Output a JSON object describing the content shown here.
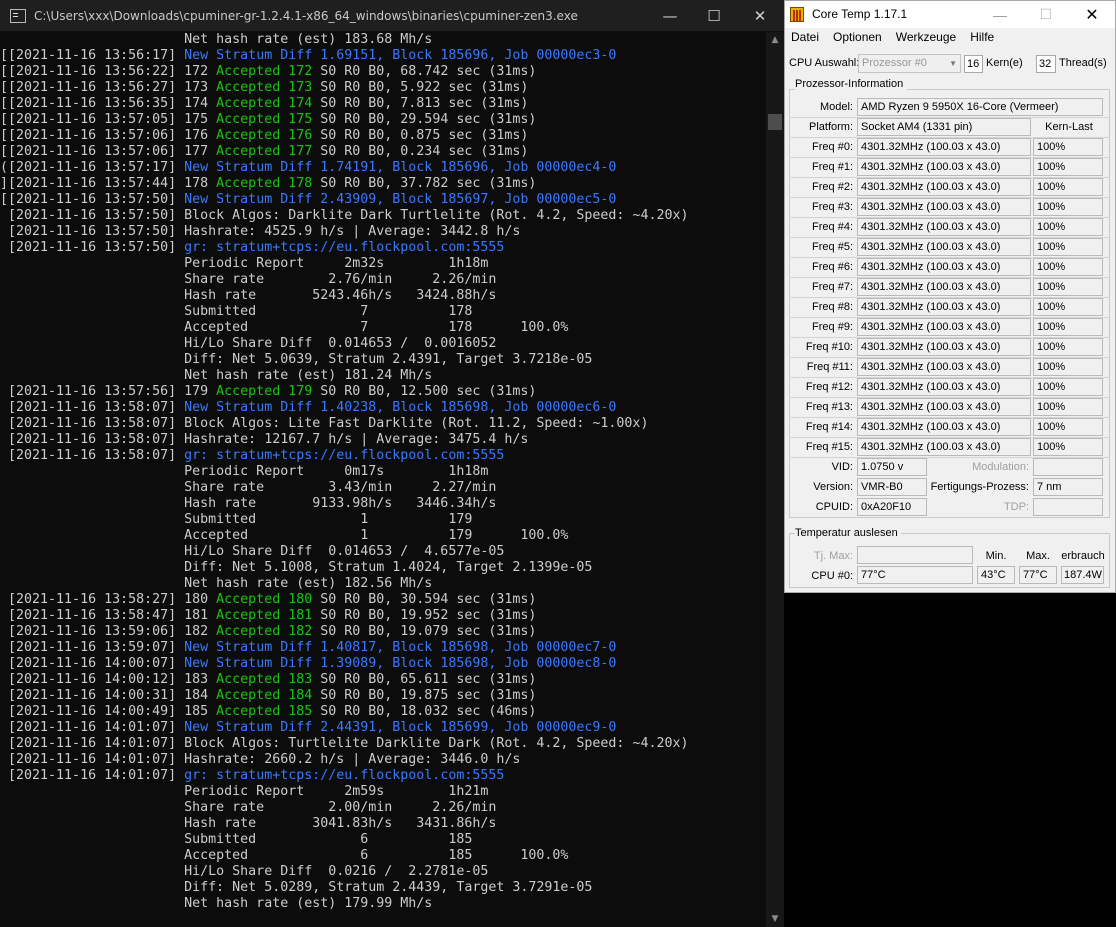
{
  "console": {
    "title": "C:\\Users\\xxx\\Downloads\\cpuminer-gr-1.2.4.1-x86_64_windows\\binaries\\cpuminer-zen3.exe",
    "controls": {
      "minimize": "—",
      "maximize": "☐",
      "close": "✕"
    },
    "lines": [
      {
        "ts": " ",
        "plain": "                      Net hash rate (est) 183.68 Mh/s"
      },
      {
        "ts": "[",
        "plain": "[2021-11-16 13:56:17] ",
        "blue": "New Stratum Diff 1.69151, Block 185696, Job 00000ec3-0"
      },
      {
        "ts": "[",
        "plain": "[2021-11-16 13:56:22] 172 ",
        "green": "Accepted 172",
        "rest": " S0 R0 B0, 68.742 sec (31ms)"
      },
      {
        "ts": "[",
        "plain": "[2021-11-16 13:56:27] 173 ",
        "green": "Accepted 173",
        "rest": " S0 R0 B0, 5.922 sec (31ms)"
      },
      {
        "ts": "[",
        "plain": "[2021-11-16 13:56:35] 174 ",
        "green": "Accepted 174",
        "rest": " S0 R0 B0, 7.813 sec (31ms)"
      },
      {
        "ts": "[",
        "plain": "[2021-11-16 13:57:05] 175 ",
        "green": "Accepted 175",
        "rest": " S0 R0 B0, 29.594 sec (31ms)"
      },
      {
        "ts": "[",
        "plain": "[2021-11-16 13:57:06] 176 ",
        "green": "Accepted 176",
        "rest": " S0 R0 B0, 0.875 sec (31ms)"
      },
      {
        "ts": "[",
        "plain": "[2021-11-16 13:57:06] 177 ",
        "green": "Accepted 177",
        "rest": " S0 R0 B0, 0.234 sec (31ms)"
      },
      {
        "ts": "(",
        "plain": "[2021-11-16 13:57:17] ",
        "blue": "New Stratum Diff 1.74191, Block 185696, Job 00000ec4-0"
      },
      {
        "ts": "]",
        "plain": "[2021-11-16 13:57:44] 178 ",
        "green": "Accepted 178",
        "rest": " S0 R0 B0, 37.782 sec (31ms)"
      },
      {
        "ts": "[",
        "plain": "[2021-11-16 13:57:50] ",
        "blue": "New Stratum Diff 2.43909, Block 185697, Job 00000ec5-0"
      },
      {
        "ts": " ",
        "plain": "[2021-11-16 13:57:50] Block Algos: Darklite Dark Turtlelite (Rot. 4.2, Speed: ~4.20x)"
      },
      {
        "ts": " ",
        "plain": "[2021-11-16 13:57:50] Hashrate: 4525.9 h/s | Average: 3442.8 h/s"
      },
      {
        "ts": " ",
        "plain": "[2021-11-16 13:57:50] ",
        "blue": "gr: stratum+tcps://eu.flockpool.com:5555"
      },
      {
        "ts": " ",
        "plain": "                      Periodic Report     2m32s        1h18m"
      },
      {
        "ts": " ",
        "plain": "                      Share rate        2.76/min     2.26/min"
      },
      {
        "ts": " ",
        "plain": "                      Hash rate       5243.46h/s   3424.88h/s"
      },
      {
        "ts": " ",
        "plain": "                      Submitted             7          178"
      },
      {
        "ts": " ",
        "plain": "                      Accepted              7          178      100.0%"
      },
      {
        "ts": " ",
        "plain": "                      Hi/Lo Share Diff  0.014653 /  0.0016052"
      },
      {
        "ts": " ",
        "plain": "                      Diff: Net 5.0639, Stratum 2.4391, Target 3.7218e-05"
      },
      {
        "ts": " ",
        "plain": "                      Net hash rate (est) 181.24 Mh/s"
      },
      {
        "ts": " ",
        "plain": "[2021-11-16 13:57:56] 179 ",
        "green": "Accepted 179",
        "rest": " S0 R0 B0, 12.500 sec (31ms)"
      },
      {
        "ts": " ",
        "plain": "[2021-11-16 13:58:07] ",
        "blue": "New Stratum Diff 1.40238, Block 185698, Job 00000ec6-0"
      },
      {
        "ts": " ",
        "plain": "[2021-11-16 13:58:07] Block Algos: Lite Fast Darklite (Rot. 11.2, Speed: ~1.00x)"
      },
      {
        "ts": " ",
        "plain": "[2021-11-16 13:58:07] Hashrate: 12167.7 h/s | Average: 3475.4 h/s"
      },
      {
        "ts": " ",
        "plain": "[2021-11-16 13:58:07] ",
        "blue": "gr: stratum+tcps://eu.flockpool.com:5555"
      },
      {
        "ts": " ",
        "plain": "                      Periodic Report     0m17s        1h18m"
      },
      {
        "ts": " ",
        "plain": "                      Share rate        3.43/min     2.27/min"
      },
      {
        "ts": " ",
        "plain": "                      Hash rate       9133.98h/s   3446.34h/s"
      },
      {
        "ts": " ",
        "plain": "                      Submitted             1          179"
      },
      {
        "ts": " ",
        "plain": "                      Accepted              1          179      100.0%"
      },
      {
        "ts": " ",
        "plain": "                      Hi/Lo Share Diff  0.014653 /  4.6577e-05"
      },
      {
        "ts": " ",
        "plain": "                      Diff: Net 5.1008, Stratum 1.4024, Target 2.1399e-05"
      },
      {
        "ts": " ",
        "plain": "                      Net hash rate (est) 182.56 Mh/s"
      },
      {
        "ts": " ",
        "plain": "[2021-11-16 13:58:27] 180 ",
        "green": "Accepted 180",
        "rest": " S0 R0 B0, 30.594 sec (31ms)"
      },
      {
        "ts": " ",
        "plain": "[2021-11-16 13:58:47] 181 ",
        "green": "Accepted 181",
        "rest": " S0 R0 B0, 19.952 sec (31ms)"
      },
      {
        "ts": " ",
        "plain": "[2021-11-16 13:59:06] 182 ",
        "green": "Accepted 182",
        "rest": " S0 R0 B0, 19.079 sec (31ms)"
      },
      {
        "ts": " ",
        "plain": "[2021-11-16 13:59:07] ",
        "blue": "New Stratum Diff 1.40817, Block 185698, Job 00000ec7-0"
      },
      {
        "ts": " ",
        "plain": "[2021-11-16 14:00:07] ",
        "blue": "New Stratum Diff 1.39089, Block 185698, Job 00000ec8-0"
      },
      {
        "ts": " ",
        "plain": "[2021-11-16 14:00:12] 183 ",
        "green": "Accepted 183",
        "rest": " S0 R0 B0, 65.611 sec (31ms)"
      },
      {
        "ts": " ",
        "plain": "[2021-11-16 14:00:31] 184 ",
        "green": "Accepted 184",
        "rest": " S0 R0 B0, 19.875 sec (31ms)"
      },
      {
        "ts": " ",
        "plain": "[2021-11-16 14:00:49] 185 ",
        "green": "Accepted 185",
        "rest": " S0 R0 B0, 18.032 sec (46ms)"
      },
      {
        "ts": " ",
        "plain": "[2021-11-16 14:01:07] ",
        "blue": "New Stratum Diff 2.44391, Block 185699, Job 00000ec9-0"
      },
      {
        "ts": " ",
        "plain": "[2021-11-16 14:01:07] Block Algos: Turtlelite Darklite Dark (Rot. 4.2, Speed: ~4.20x)"
      },
      {
        "ts": " ",
        "plain": "[2021-11-16 14:01:07] Hashrate: 2660.2 h/s | Average: 3446.0 h/s"
      },
      {
        "ts": " ",
        "plain": "[2021-11-16 14:01:07] ",
        "blue": "gr: stratum+tcps://eu.flockpool.com:5555"
      },
      {
        "ts": " ",
        "plain": "                      Periodic Report     2m59s        1h21m"
      },
      {
        "ts": " ",
        "plain": "                      Share rate        2.00/min     2.26/min"
      },
      {
        "ts": " ",
        "plain": "                      Hash rate       3041.83h/s   3431.86h/s"
      },
      {
        "ts": " ",
        "plain": "                      Submitted             6          185"
      },
      {
        "ts": " ",
        "plain": "                      Accepted              6          185      100.0%"
      },
      {
        "ts": " ",
        "plain": "                      Hi/Lo Share Diff  0.0216 /  2.2781e-05"
      },
      {
        "ts": " ",
        "plain": "                      Diff: Net 5.0289, Stratum 2.4439, Target 3.7291e-05"
      },
      {
        "ts": " ",
        "plain": "                      Net hash rate (est) 179.99 Mh/s"
      }
    ]
  },
  "coretemp": {
    "title": "Core Temp 1.17.1",
    "controls": {
      "minimize": "—",
      "maximize": "☐",
      "close": "✕"
    },
    "menu": [
      "Datei",
      "Optionen",
      "Werkzeuge",
      "Hilfe"
    ],
    "cpu_select_label": "CPU Auswahl:",
    "cpu_select_value": "Prozessor #0",
    "cores": "16",
    "cores_label": "Kern(e)",
    "threads": "32",
    "threads_label": "Thread(s)",
    "processor_info_label": "Prozessor-Information",
    "model_label": "Model:",
    "model": "AMD Ryzen 9 5950X 16-Core (Vermeer)",
    "platform_label": "Platform:",
    "platform": "Socket AM4 (1331 pin)",
    "load_header": "Kern-Last",
    "frequencies": [
      {
        "label": "Freq #0:",
        "value": "4301.32MHz (100.03 x 43.0)",
        "load": "100%"
      },
      {
        "label": "Freq #1:",
        "value": "4301.32MHz (100.03 x 43.0)",
        "load": "100%"
      },
      {
        "label": "Freq #2:",
        "value": "4301.32MHz (100.03 x 43.0)",
        "load": "100%"
      },
      {
        "label": "Freq #3:",
        "value": "4301.32MHz (100.03 x 43.0)",
        "load": "100%"
      },
      {
        "label": "Freq #4:",
        "value": "4301.32MHz (100.03 x 43.0)",
        "load": "100%"
      },
      {
        "label": "Freq #5:",
        "value": "4301.32MHz (100.03 x 43.0)",
        "load": "100%"
      },
      {
        "label": "Freq #6:",
        "value": "4301.32MHz (100.03 x 43.0)",
        "load": "100%"
      },
      {
        "label": "Freq #7:",
        "value": "4301.32MHz (100.03 x 43.0)",
        "load": "100%"
      },
      {
        "label": "Freq #8:",
        "value": "4301.32MHz (100.03 x 43.0)",
        "load": "100%"
      },
      {
        "label": "Freq #9:",
        "value": "4301.32MHz (100.03 x 43.0)",
        "load": "100%"
      },
      {
        "label": "Freq #10:",
        "value": "4301.32MHz (100.03 x 43.0)",
        "load": "100%"
      },
      {
        "label": "Freq #11:",
        "value": "4301.32MHz (100.03 x 43.0)",
        "load": "100%"
      },
      {
        "label": "Freq #12:",
        "value": "4301.32MHz (100.03 x 43.0)",
        "load": "100%"
      },
      {
        "label": "Freq #13:",
        "value": "4301.32MHz (100.03 x 43.0)",
        "load": "100%"
      },
      {
        "label": "Freq #14:",
        "value": "4301.32MHz (100.03 x 43.0)",
        "load": "100%"
      },
      {
        "label": "Freq #15:",
        "value": "4301.32MHz (100.03 x 43.0)",
        "load": "100%"
      }
    ],
    "vid_label": "VID:",
    "vid": "1.0750 v",
    "modulation_label": "Modulation:",
    "modulation": "",
    "version_label": "Version:",
    "version": "VMR-B0",
    "process_label": "Fertigungs-Prozess:",
    "process": "7 nm",
    "cpuid_label": "CPUID:",
    "cpuid": "0xA20F10",
    "tdp_label": "TDP:",
    "tdp": "",
    "temp_section_label": "Temperatur auslesen",
    "tjmax_label": "Tj. Max:",
    "tjmax": "",
    "min_label": "Min.",
    "max_label": "Max.",
    "power_label": "erbrauch",
    "cpu0_label": "CPU #0:",
    "cpu0_temp": "77°C",
    "cpu0_min": "43°C",
    "cpu0_max": "77°C",
    "cpu0_power": "187.4W"
  }
}
